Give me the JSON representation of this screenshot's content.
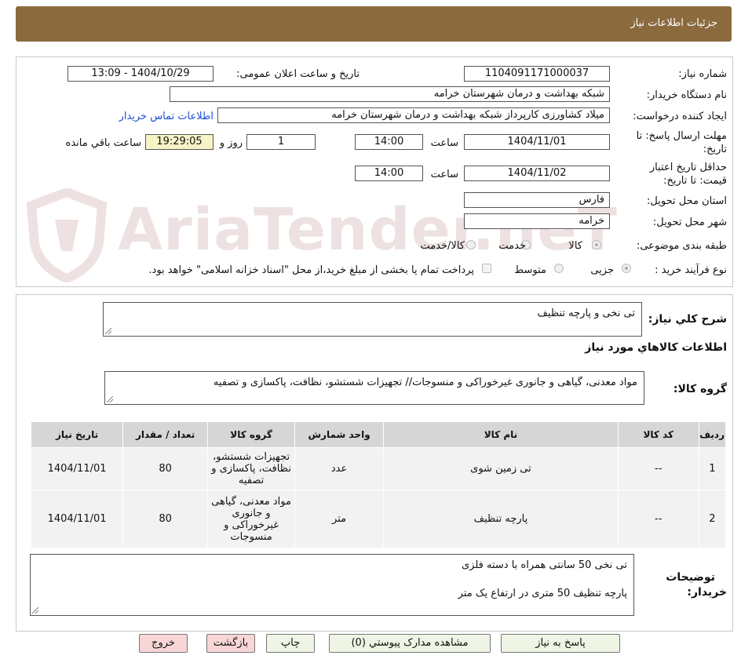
{
  "header": {
    "title": "جزئیات اطلاعات نیاز"
  },
  "form": {
    "need_number_label": "شماره نیاز:",
    "need_number": "1104091171000037",
    "announce_label": "تاریخ و ساعت اعلان عمومی:",
    "announce_value": "1404/10/29 - 13:09",
    "buyer_org_label": "نام دستگاه خریدار:",
    "buyer_org": "شبکه بهداشت و درمان شهرستان خرامه",
    "creator_label": "ایجاد کننده درخواست:",
    "creator": "میلاد کشاورزی کارپرداز شبکه بهداشت و درمان شهرستان خرامه",
    "contact_link": "اطلاعات تماس خریدار",
    "reply_deadline_label_1": "مهلت ارسال پاسخ: تا",
    "reply_deadline_label_2": "تاریخ:",
    "reply_date": "1404/11/01",
    "time_label": "ساعت",
    "reply_time": "14:00",
    "days_value": "1",
    "days_label": "روز و",
    "remaining_time": "19:29:05",
    "remaining_label": "ساعت باقي مانده",
    "validity_label_1": "حداقل تاریخ اعتبار",
    "validity_label_2": "قیمت: تا تاریخ:",
    "validity_date": "1404/11/02",
    "validity_time": "14:00",
    "province_label": "استان محل تحویل:",
    "province": "فارس",
    "city_label": "شهر محل تحویل:",
    "city": "خرامه",
    "category_label": "طبقه بندی موضوعی:",
    "category_options": [
      "کالا",
      "خدمت",
      "کالا/خدمت"
    ],
    "process_label": "نوع فرآیند خرید :",
    "process_options": [
      "جزیی",
      "متوسط"
    ],
    "payment_note": "پرداخت تمام یا بخشی از مبلغ خرید،از محل \"اسناد خزانه اسلامی\" خواهد بود."
  },
  "details": {
    "summary_label": "شرح کلي نیاز:",
    "summary": "تی نخی و پارچه تنظیف",
    "goods_info_title": "اطلاعات کالاهاي مورد نياز",
    "goods_group_label": "گروه کالا:",
    "goods_group": "مواد معدنی، گیاهی و جانوری غیرخوراکی و منسوجات// تجهیزات شستشو، نظافت، پاکسازی و تصفیه",
    "table": {
      "headers": [
        "ردیف",
        "کد کالا",
        "نام کالا",
        "واحد شمارش",
        "گروه کالا",
        "تعداد / مقدار",
        "تاریخ نیاز"
      ],
      "rows": [
        [
          "1",
          "--",
          "تی زمین شوی",
          "عدد",
          "تجهیزات شستشو، نظافت، پاکسازی و تصفیه",
          "80",
          "1404/11/01"
        ],
        [
          "2",
          "--",
          "پارچه تنظیف",
          "متر",
          "مواد معدنی، گیاهی و جانوری غیرخوراکی و منسوجات",
          "80",
          "1404/11/01"
        ]
      ]
    },
    "buyer_notes_label_1": "توضیحات",
    "buyer_notes_label_2": "خریدار:",
    "buyer_notes_line1": "تی نخی 50 سانتی همراه با دسته فلزی",
    "buyer_notes_line2": "پارچه تنظیف 50 متری در ارتفاع یک متر"
  },
  "buttons": {
    "reply": "پاسخ به نیاز",
    "attachments": "مشاهده مدارک پیوستي (0)",
    "print": "چاپ",
    "back": "بازگشت",
    "exit": "خروج"
  },
  "watermark": {
    "text": "AriaTender.neT"
  }
}
